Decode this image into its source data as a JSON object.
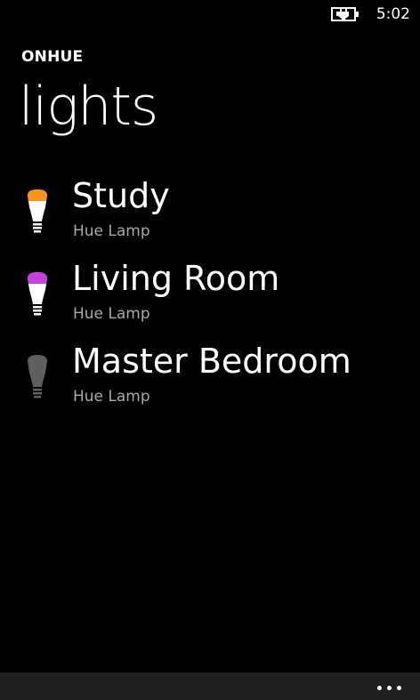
{
  "status_bar": {
    "time": "5:02",
    "battery_icon": "battery-charging-icon"
  },
  "header": {
    "app_title": "ONHUE",
    "page_title": "lights"
  },
  "lights": [
    {
      "name": "Study",
      "type": "Hue Lamp",
      "color": "#f7941e",
      "icon": "light-bulb-icon"
    },
    {
      "name": "Living Room",
      "type": "Hue Lamp",
      "color": "#c63fe0",
      "icon": "light-bulb-icon"
    },
    {
      "name": "Master Bedroom",
      "type": "Hue Lamp",
      "color": "#5f5f5f",
      "icon": "light-bulb-icon"
    }
  ],
  "app_bar": {
    "more_icon": "more-dots-icon"
  },
  "colors": {
    "background": "#000000",
    "text": "#ffffff",
    "subtext": "#a8a8a8",
    "app_bar": "#1f1f1f"
  }
}
